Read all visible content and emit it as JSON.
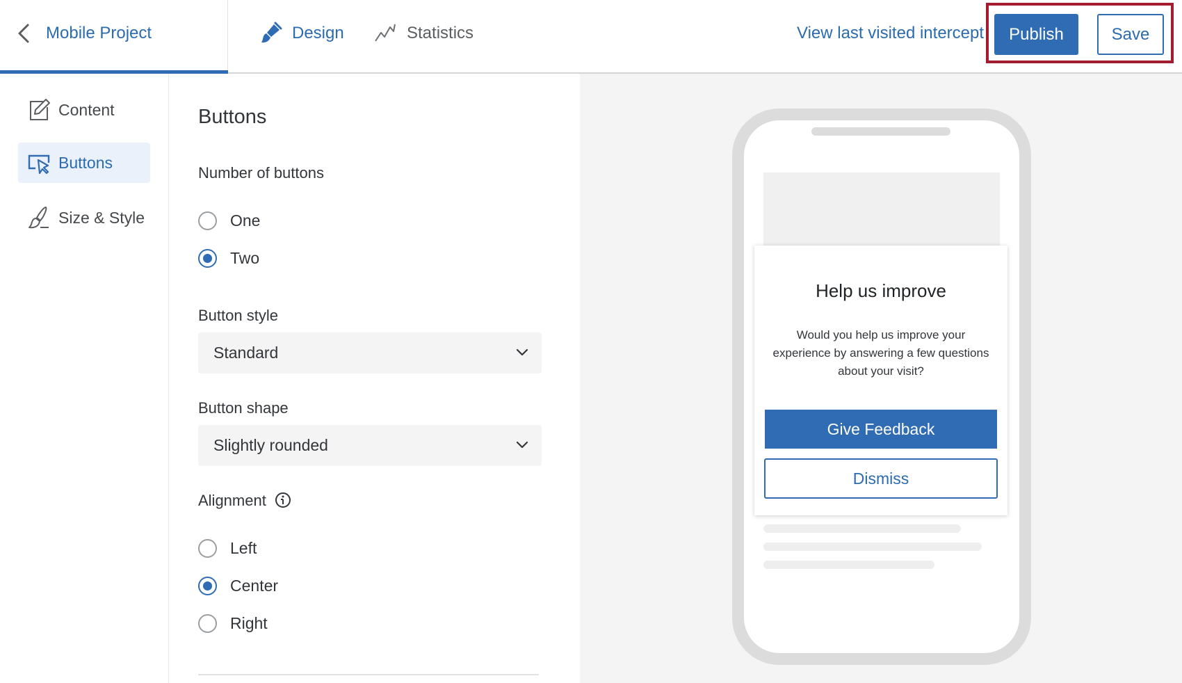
{
  "header": {
    "project_title": "Mobile Project",
    "back_icon": "chevron-left-icon",
    "tabs": [
      {
        "label": "Design",
        "icon": "paintbrush-icon",
        "active": true
      },
      {
        "label": "Statistics",
        "icon": "line-chart-icon",
        "active": false
      }
    ],
    "last_visited_link": "View last visited intercept",
    "publish_label": "Publish",
    "save_label": "Save"
  },
  "sidebar": {
    "items": [
      {
        "label": "Content",
        "icon": "edit-icon",
        "active": false
      },
      {
        "label": "Buttons",
        "icon": "cursor-click-icon",
        "active": true
      },
      {
        "label": "Size & Style",
        "icon": "brush-icon",
        "active": false
      }
    ]
  },
  "panel": {
    "title": "Buttons",
    "number_of_buttons": {
      "label": "Number of buttons",
      "options": [
        "One",
        "Two"
      ],
      "selected": "Two"
    },
    "button_style": {
      "label": "Button style",
      "value": "Standard"
    },
    "button_shape": {
      "label": "Button shape",
      "value": "Slightly rounded"
    },
    "alignment": {
      "label": "Alignment",
      "options": [
        "Left",
        "Center",
        "Right"
      ],
      "selected": "Center"
    }
  },
  "preview": {
    "title": "Help us improve",
    "body": "Would you help us improve your experience by answering a few questions about your visit?",
    "primary_button": "Give Feedback",
    "secondary_button": "Dismiss"
  },
  "colors": {
    "accent": "#2f6cb3",
    "link": "#2b6cb0",
    "highlight": "#a51c30",
    "preview_bg": "#f4f4f4"
  }
}
